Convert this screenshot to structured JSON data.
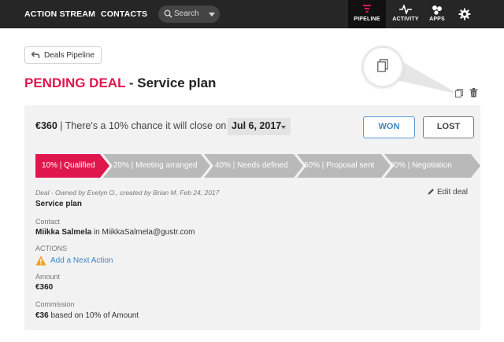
{
  "topbar": {
    "nav": [
      "ACTION STREAM",
      "CONTACTS"
    ],
    "search_placeholder": "Search",
    "tabs": [
      {
        "label": "PIPELINE",
        "icon": "filter-icon",
        "active": true
      },
      {
        "label": "ACTIVITY",
        "icon": "pulse-icon",
        "active": false
      },
      {
        "label": "APPS",
        "icon": "apps-icon",
        "active": false
      }
    ],
    "settings_icon": "gear-icon"
  },
  "back_button": {
    "label": "Deals Pipeline",
    "icon": "back-arrow-icon"
  },
  "title": {
    "status": "PENDING DEAL",
    "separator": " - ",
    "name": "Service plan"
  },
  "deal": {
    "amount": "€360",
    "chance_text": " | There's a 10% chance it will close on ",
    "close_date": "Jul 6, 2017",
    "won_label": "WON",
    "lost_label": "LOST",
    "stages": [
      {
        "label": "10% | Qualified",
        "active": true
      },
      {
        "label": "20% | Meeting arranged",
        "active": false
      },
      {
        "label": "40% | Needs defined",
        "active": false
      },
      {
        "label": "60% | Proposal sent",
        "active": false
      },
      {
        "label": "80% | Negotiation",
        "active": false
      }
    ],
    "meta": "Deal - Owned by Evelyn O., created by Brian M. Feb 24, 2017",
    "edit_label": "Edit deal",
    "name": "Service plan",
    "contact_label": "Contact",
    "contact_name": "Miikka Salmela",
    "contact_in": " in ",
    "contact_company": "MiikkaSalmela@gustr.com",
    "actions_label": "ACTIONS",
    "add_action": "Add a Next Action",
    "amount_label": "Amount",
    "amount_value": "€360",
    "commission_label": "Commission",
    "commission_value": "€36",
    "commission_basis": " based on 10% of Amount"
  },
  "colors": {
    "accent": "#e0174d",
    "stage_active": "#e0174d",
    "stage_inactive": "#b9b9b9",
    "link": "#3d85c6",
    "topbar": "#262626"
  }
}
